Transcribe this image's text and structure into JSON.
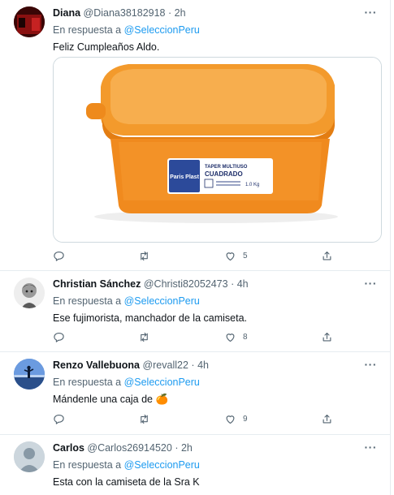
{
  "tweets": [
    {
      "name": "Diana",
      "handle": "@Diana38182918",
      "dot": "·",
      "time": "2h",
      "reply_prefix": "En respuesta a",
      "reply_mention": "@SeleccionPeru",
      "text": "Feliz Cumpleaños Aldo.",
      "like_count": "5",
      "media": {
        "label_brand": "Paris Plast",
        "label_line1": "TAPER MULTIUSO",
        "label_line2": "CUADRADO",
        "label_size": "1.0 Kg"
      }
    },
    {
      "name": "Christian Sánchez",
      "handle": "@Christi82052473",
      "dot": "·",
      "time": "4h",
      "reply_prefix": "En respuesta a",
      "reply_mention": "@SeleccionPeru",
      "text": "Ese fujimorista, manchador de la camiseta.",
      "like_count": "8"
    },
    {
      "name": "Renzo Vallebuona",
      "handle": "@revall22",
      "dot": "·",
      "time": "4h",
      "reply_prefix": "En respuesta a",
      "reply_mention": "@SeleccionPeru",
      "text": "Mándenle una caja de",
      "emoji": "🍊",
      "like_count": "9"
    },
    {
      "name": "Carlos",
      "handle": "@Carlos26914520",
      "dot": "·",
      "time": "2h",
      "reply_prefix": "En respuesta a",
      "reply_mention": "@SeleccionPeru",
      "text": "Esta con la camiseta de la Sra K"
    }
  ],
  "icons": {
    "more": "more-icon",
    "reply": "reply-icon",
    "retweet": "retweet-icon",
    "like": "like-icon",
    "share": "share-icon"
  },
  "colors": {
    "link": "#1d9bf0",
    "secondary_text": "#536471",
    "container": "#f08a1e"
  }
}
